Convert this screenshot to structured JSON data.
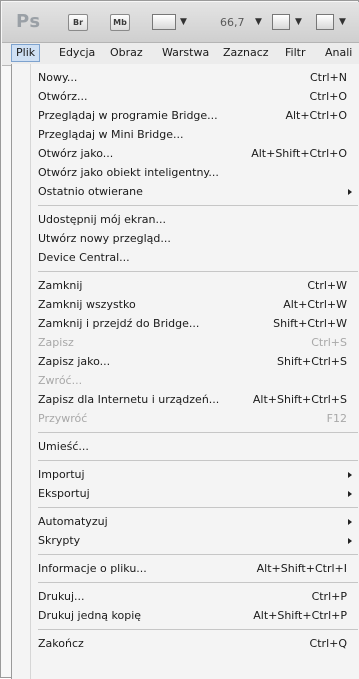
{
  "app": {
    "logo": "Ps",
    "bridge_label": "Br",
    "minibridge_label": "Mb",
    "zoom_value": "66,7"
  },
  "menubar": {
    "items": [
      {
        "label": "Plik"
      },
      {
        "label": "Edycja"
      },
      {
        "label": "Obraz"
      },
      {
        "label": "Warstwa"
      },
      {
        "label": "Zaznacz"
      },
      {
        "label": "Filtr"
      },
      {
        "label": "Anali"
      }
    ]
  },
  "menu": {
    "items": [
      {
        "label": "Nowy...",
        "shortcut": "Ctrl+N"
      },
      {
        "label": "Otwórz...",
        "shortcut": "Ctrl+O"
      },
      {
        "label": "Przeglądaj w programie Bridge...",
        "shortcut": "Alt+Ctrl+O"
      },
      {
        "label": "Przeglądaj w Mini Bridge...",
        "shortcut": ""
      },
      {
        "label": "Otwórz jako...",
        "shortcut": "Alt+Shift+Ctrl+O"
      },
      {
        "label": "Otwórz jako obiekt inteligentny...",
        "shortcut": ""
      },
      {
        "label": "Ostatnio otwierane",
        "shortcut": ""
      },
      {
        "label": "Udostępnij mój ekran...",
        "shortcut": ""
      },
      {
        "label": "Utwórz nowy przegląd...",
        "shortcut": ""
      },
      {
        "label": "Device Central...",
        "shortcut": ""
      },
      {
        "label": "Zamknij",
        "shortcut": "Ctrl+W"
      },
      {
        "label": "Zamknij wszystko",
        "shortcut": "Alt+Ctrl+W"
      },
      {
        "label": "Zamknij i przejdź do Bridge...",
        "shortcut": "Shift+Ctrl+W"
      },
      {
        "label": "Zapisz",
        "shortcut": "Ctrl+S"
      },
      {
        "label": "Zapisz jako...",
        "shortcut": "Shift+Ctrl+S"
      },
      {
        "label": "Zwróć...",
        "shortcut": ""
      },
      {
        "label": "Zapisz dla Internetu i urządzeń...",
        "shortcut": "Alt+Shift+Ctrl+S"
      },
      {
        "label": "Przywróć",
        "shortcut": "F12"
      },
      {
        "label": "Umieść...",
        "shortcut": ""
      },
      {
        "label": "Importuj",
        "shortcut": ""
      },
      {
        "label": "Eksportuj",
        "shortcut": ""
      },
      {
        "label": "Automatyzuj",
        "shortcut": ""
      },
      {
        "label": "Skrypty",
        "shortcut": ""
      },
      {
        "label": "Informacje o pliku...",
        "shortcut": "Alt+Shift+Ctrl+I"
      },
      {
        "label": "Drukuj...",
        "shortcut": "Ctrl+P"
      },
      {
        "label": "Drukuj jedną kopię",
        "shortcut": "Alt+Shift+Ctrl+P"
      },
      {
        "label": "Zakończ",
        "shortcut": "Ctrl+Q"
      }
    ]
  }
}
